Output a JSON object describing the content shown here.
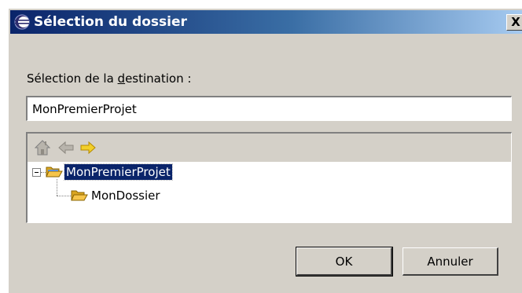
{
  "window": {
    "title": "Sélection du dossier",
    "close_glyph": "X"
  },
  "destination": {
    "label_before": "Sélection de la ",
    "label_mnemonic": "d",
    "label_after": "estination :",
    "value": "MonPremierProjet"
  },
  "toolbar": {
    "icons": [
      "home-icon",
      "back-arrow-icon",
      "forward-arrow-icon"
    ]
  },
  "tree": {
    "root": {
      "label": "MonPremierProjet",
      "expanded": true,
      "selected": true
    },
    "children": [
      {
        "label": "MonDossier"
      }
    ]
  },
  "buttons": {
    "ok_label": "OK",
    "cancel_label": "Annuler"
  },
  "colors": {
    "title_bar": "#0a246a",
    "selection": "#0a246a",
    "dialog_background": "#d4d0c8",
    "folder": "#f6c54a",
    "forward_arrow": "#f2cf2a"
  }
}
